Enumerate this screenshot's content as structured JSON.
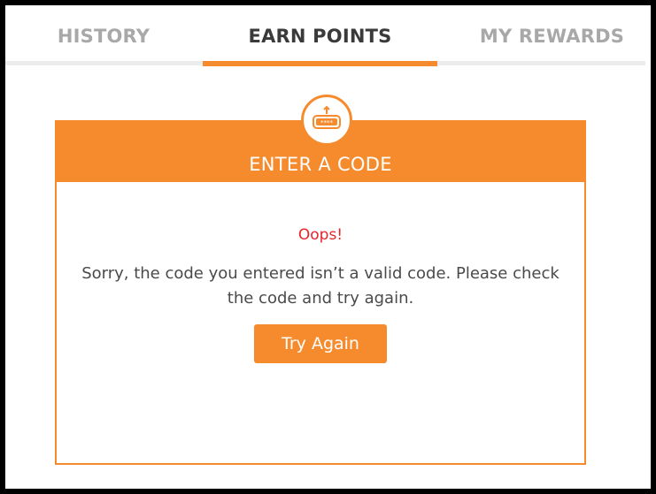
{
  "tabs": {
    "history": "HISTORY",
    "earn_points": "EARN POINTS",
    "my_rewards": "MY REWARDS",
    "active": "earn_points"
  },
  "card": {
    "title": "ENTER A CODE",
    "icon": "code-entry-icon",
    "error_heading": "Oops!",
    "error_message": "Sorry, the code you entered isn’t a valid code. Please check the code and try again.",
    "button_label": "Try Again"
  },
  "colors": {
    "accent": "#f68b2e",
    "error": "#e8232a",
    "tab_inactive": "#a8a8a8",
    "tab_active": "#3a3a3a"
  }
}
